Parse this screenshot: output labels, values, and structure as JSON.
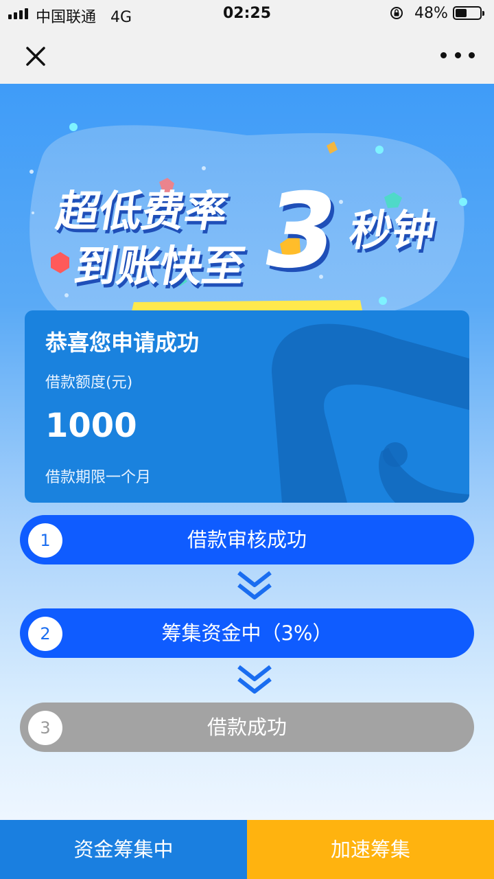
{
  "status_bar": {
    "carrier": "中国联通",
    "network": "4G",
    "time": "02:25",
    "battery_percent": "48%",
    "battery_level": 0.48
  },
  "nav": {
    "close_icon": "close-icon",
    "more_icon": "more-icon"
  },
  "banner": {
    "line1": "超低费率",
    "line2": "到账快至",
    "big_number": "3",
    "unit": "秒钟"
  },
  "card": {
    "title": "恭喜您申请成功",
    "limit_label": "借款额度(元)",
    "limit_value": "1000",
    "term": "借款期限一个月"
  },
  "steps": [
    {
      "number": "1",
      "label": "借款审核成功",
      "state": "active"
    },
    {
      "number": "2",
      "label": "筹集资金中（3%）",
      "state": "active"
    },
    {
      "number": "3",
      "label": "借款成功",
      "state": "inactive"
    }
  ],
  "bottom": {
    "left_label": "资金筹集中",
    "right_label": "加速筹集"
  },
  "colors": {
    "primary": "#0f5cff",
    "card": "#1a82de",
    "accent": "#ffb30f",
    "inactive": "#a3a3a3"
  }
}
